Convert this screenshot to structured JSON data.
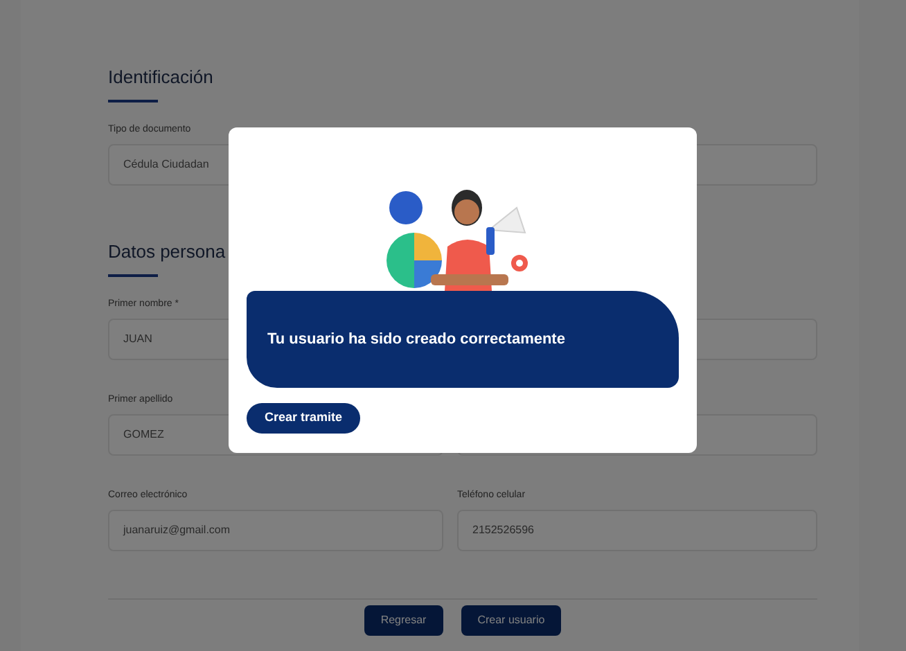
{
  "form": {
    "sections": [
      {
        "title": "Identificación",
        "rows": [
          [
            {
              "label": "Tipo de documento",
              "value": "Cédula Ciudadan"
            },
            {}
          ]
        ]
      },
      {
        "title": "Datos persona",
        "rows": [
          [
            {
              "label": "Primer nombre *",
              "value": "JUAN"
            },
            {}
          ],
          [
            {
              "label": "Primer apellido",
              "value": "GOMEZ"
            },
            {}
          ],
          [
            {
              "label": "Correo electrónico",
              "value": "juanaruiz@gmail.com"
            },
            {
              "label": "Teléfono celular",
              "value": "2152526596"
            }
          ]
        ]
      }
    ],
    "buttons": [
      "Regresar",
      "Crear usuario"
    ]
  },
  "modal": {
    "message": "Tu usuario ha sido creado correctamente",
    "button": "Crear tramite"
  }
}
